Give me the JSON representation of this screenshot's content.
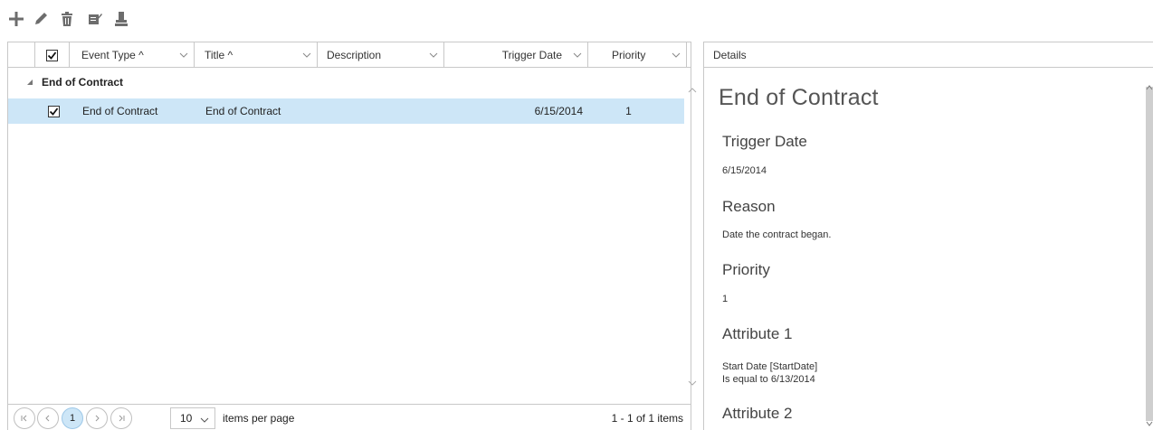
{
  "toolbar": {
    "buttons": [
      {
        "name": "add",
        "icon": "plus-icon"
      },
      {
        "name": "edit",
        "icon": "pencil-icon"
      },
      {
        "name": "delete",
        "icon": "trash-icon"
      },
      {
        "name": "notes",
        "icon": "note-edit-icon"
      },
      {
        "name": "stamp",
        "icon": "stamp-icon"
      }
    ]
  },
  "grid": {
    "columns": [
      {
        "key": "select",
        "label": ""
      },
      {
        "key": "event_type",
        "label": "Event Type ^"
      },
      {
        "key": "title",
        "label": "Title ^"
      },
      {
        "key": "description",
        "label": "Description"
      },
      {
        "key": "trigger_date",
        "label": "Trigger Date"
      },
      {
        "key": "priority",
        "label": "Priority"
      }
    ],
    "header_checked": true,
    "group": {
      "label": "End of Contract",
      "expanded": true
    },
    "rows": [
      {
        "checked": true,
        "event_type": "End of Contract",
        "title": "End of Contract",
        "description": "",
        "trigger_date": "6/15/2014",
        "priority": "1",
        "selected": true
      }
    ],
    "pager": {
      "pages": [
        "1"
      ],
      "current_page": "1",
      "page_size": "10",
      "page_size_label": "items per page",
      "info": "1 - 1 of 1 items"
    }
  },
  "details": {
    "header": "Details",
    "title": "End of Contract",
    "sections": [
      {
        "heading": "Trigger Date",
        "lines": [
          "6/15/2014"
        ]
      },
      {
        "heading": "Reason",
        "lines": [
          "Date the contract began."
        ]
      },
      {
        "heading": "Priority",
        "lines": [
          "1"
        ]
      },
      {
        "heading": "Attribute 1",
        "lines": [
          "Start Date [StartDate]",
          "Is equal to 6/13/2014"
        ]
      },
      {
        "heading": "Attribute 2",
        "lines": []
      }
    ]
  },
  "colors": {
    "selection": "#cde6f7",
    "border": "#c8c8c8",
    "icon": "#6d6d6d"
  }
}
